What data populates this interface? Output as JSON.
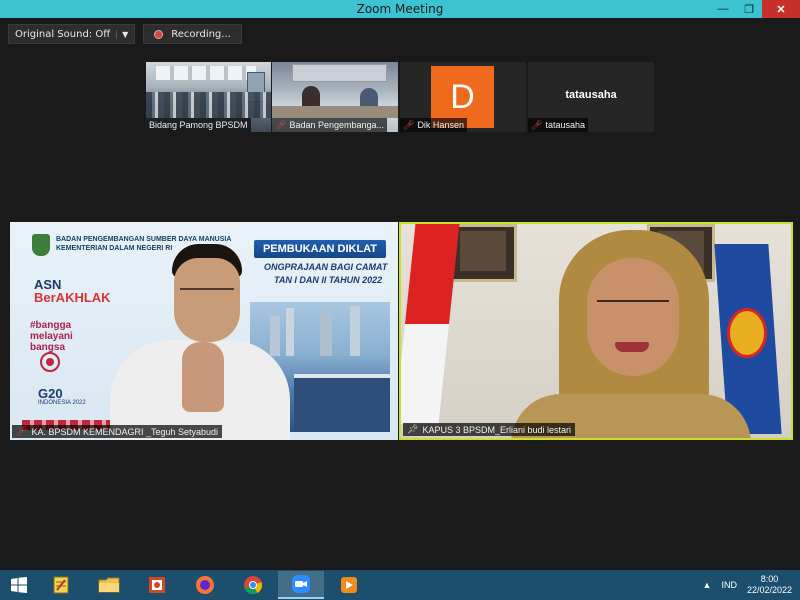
{
  "window": {
    "title": "Zoom Meeting",
    "minimize_glyph": "—",
    "maximize_glyph": "❐",
    "close_glyph": "✕"
  },
  "toolbar": {
    "original_sound_label": "Original Sound: Off",
    "original_sound_caret": "▼",
    "recording_label": "Recording..."
  },
  "thumbnails": [
    {
      "name": "Bidang Pamong BPSDM",
      "muted": false
    },
    {
      "name": "Badan Pengembanga...",
      "muted": true
    },
    {
      "name": "Dik Hansen",
      "muted": true,
      "initial": "D",
      "avatar_color": "#f06a1e"
    },
    {
      "name": "tatausaha",
      "muted": true,
      "display_name": "tatausaha"
    }
  ],
  "main_tiles": {
    "left": {
      "label": "KA. BPSDM KEMENDAGRI _Teguh Setyabudi",
      "org_line1": "BADAN PENGEMBANGAN SUMBER DAYA MANUSIA",
      "org_line2": "KEMENTERIAN DALAM NEGERI RI",
      "asn": "ASN",
      "berakhlak": "BerAKHLAK",
      "bangga1": "#bangga",
      "bangga2": "melayani",
      "bangga3": "bangsa",
      "g20": "G20",
      "g20_sub": "INDONESIA 2022",
      "banner_title": "PEMBUKAAN DIKLAT",
      "banner_sub1": "ONGPRAJAAN BAGI CAMAT",
      "banner_sub2": "TAN I DAN II TAHUN 2022"
    },
    "right": {
      "label": "KAPUS 3 BPSDM_Erliani budi lestari",
      "active_speaker_color": "#c8e02c"
    }
  },
  "taskbar": {
    "apps": [
      "start",
      "notes",
      "file-explorer",
      "powerpoint",
      "firefox",
      "chrome",
      "zoom",
      "media-player"
    ],
    "tray_caret": "▲",
    "language": "IND",
    "time": "8:00",
    "date": "22/02/2022"
  }
}
